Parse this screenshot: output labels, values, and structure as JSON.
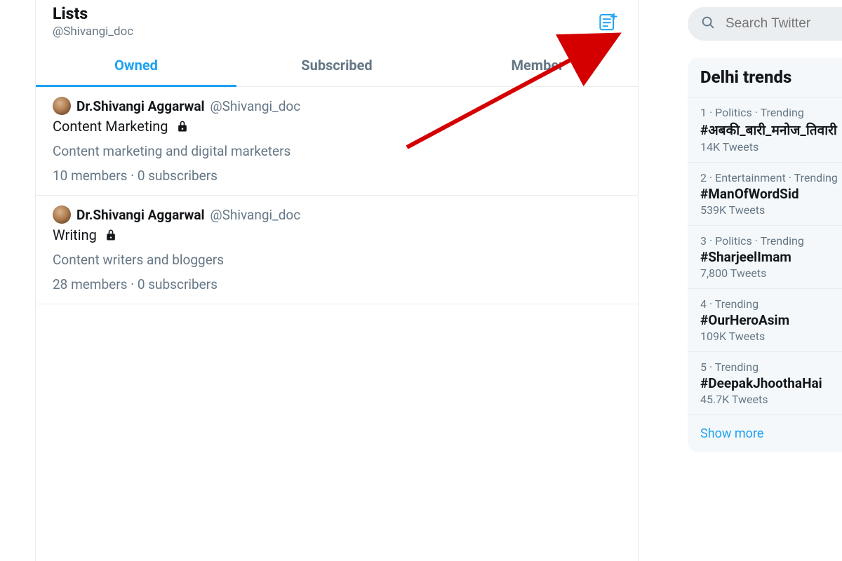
{
  "header": {
    "title": "Lists",
    "handle": "@Shivangi_doc"
  },
  "tabs": {
    "owned": "Owned",
    "subscribed": "Subscribed",
    "member": "Member",
    "active": "owned"
  },
  "lists": [
    {
      "author_name": "Dr.Shivangi Aggarwal",
      "author_handle": "@Shivangi_doc",
      "title": "Content Marketing",
      "private": true,
      "description": "Content marketing and digital marketers",
      "stats": "10 members · 0 subscribers"
    },
    {
      "author_name": "Dr.Shivangi Aggarwal",
      "author_handle": "@Shivangi_doc",
      "title": "Writing",
      "private": true,
      "description": "Content writers and bloggers",
      "stats": "28 members · 0 subscribers"
    }
  ],
  "search": {
    "placeholder": "Search Twitter"
  },
  "trends": {
    "title": "Delhi trends",
    "items": [
      {
        "meta": "1 · Politics · Trending",
        "name": "#अबकी_बारी_मनोज_तिवारी",
        "count": "14K Tweets"
      },
      {
        "meta": "2 · Entertainment · Trending",
        "name": "#ManOfWordSid",
        "count": "539K Tweets"
      },
      {
        "meta": "3 · Politics · Trending",
        "name": "#SharjeelImam",
        "count": "7,800 Tweets"
      },
      {
        "meta": "4 · Trending",
        "name": "#OurHeroAsim",
        "count": "109K Tweets"
      },
      {
        "meta": "5 · Trending",
        "name": "#DeepakJhoothaHai",
        "count": "45.7K Tweets"
      }
    ],
    "show_more": "Show more"
  },
  "colors": {
    "accent": "#1da1f2",
    "arrow": "#d40000"
  }
}
